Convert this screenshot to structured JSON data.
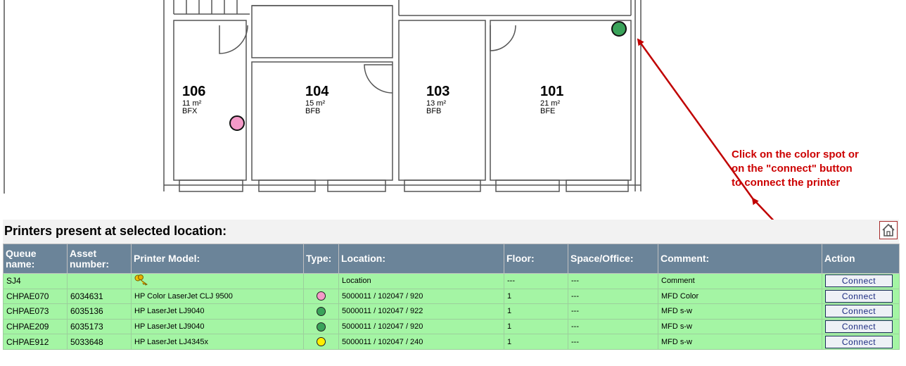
{
  "floorplan": {
    "rooms": [
      {
        "number": "106",
        "area": "11 m²",
        "code": "BFX"
      },
      {
        "number": "104",
        "area": "15 m²",
        "code": "BFB"
      },
      {
        "number": "103",
        "area": "13 m²",
        "code": "BFB"
      },
      {
        "number": "101",
        "area": "21 m²",
        "code": "BFE"
      }
    ],
    "spots": [
      {
        "room": "106",
        "color": "#f49ac8"
      },
      {
        "room": "101",
        "color": "#3aa35a"
      }
    ]
  },
  "annotation": {
    "lines": [
      "Click on the color spot or",
      "on the \"connect\" button",
      "to connect the printer"
    ],
    "color": "#cc0000"
  },
  "section": {
    "title": "Printers present at selected location:",
    "home_icon": "home-icon"
  },
  "table": {
    "headers": {
      "queue": "Queue name:",
      "asset": "Asset number:",
      "model": "Printer Model:",
      "type": "Type:",
      "location": "Location:",
      "floor": "Floor:",
      "space": "Space/Office:",
      "comment": "Comment:",
      "action": "Action"
    },
    "rows": [
      {
        "queue": "SJ4",
        "asset": "",
        "model": "",
        "model_icon": "key-icon",
        "type_color": "",
        "location": "Location",
        "floor": "---",
        "space": "---",
        "comment": "Comment",
        "action": "Connect"
      },
      {
        "queue": "CHPAE070",
        "asset": "6034631",
        "model": "HP Color LaserJet CLJ 9500",
        "type_color": "#f49ac8",
        "location": "5000011 / 102047 / 920",
        "floor": "1",
        "space": "---",
        "comment": "MFD Color",
        "action": "Connect"
      },
      {
        "queue": "CHPAE073",
        "asset": "6035136",
        "model": "HP LaserJet LJ9040",
        "type_color": "#3aa35a",
        "location": "5000011 / 102047 / 922",
        "floor": "1",
        "space": "---",
        "comment": "MFD s-w",
        "action": "Connect"
      },
      {
        "queue": "CHPAE209",
        "asset": "6035173",
        "model": "HP LaserJet LJ9040",
        "type_color": "#3aa35a",
        "location": "5000011 / 102047 / 920",
        "floor": "1",
        "space": "---",
        "comment": "MFD s-w",
        "action": "Connect"
      },
      {
        "queue": "CHPAE912",
        "asset": "5033648",
        "model": "HP LaserJet LJ4345x",
        "type_color": "#ffee00",
        "location": "5000011 / 102047 / 240",
        "floor": "1",
        "space": "---",
        "comment": "MFD s-w",
        "action": "Connect"
      }
    ]
  }
}
